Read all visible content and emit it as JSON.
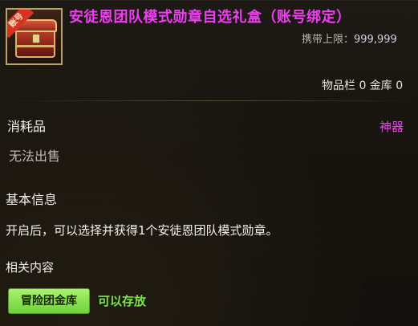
{
  "item": {
    "bound_tag": "账号",
    "name": "安徒恩团队模式勋章自选礼盒（账号绑定）",
    "carry_limit_label": "携带上限：",
    "carry_limit_value": "999,999",
    "storage_text": "物品栏 0 金库 0"
  },
  "details": {
    "category": "消耗品",
    "rarity": "神器",
    "sell_status": "无法出售",
    "basic_info_title": "基本信息",
    "description": "开启后，可以选择并获得1个安徒恩团队模式勋章。",
    "related_title": "相关内容",
    "related_tag": "冒险团金库",
    "related_note": "可以存放"
  },
  "colors": {
    "name": "#ee3ff0",
    "rarity": "#e84bea",
    "tag_bg": "#8ae354",
    "tag_note": "#7de34a"
  },
  "icons": {
    "item": "treasure-chest-icon"
  }
}
